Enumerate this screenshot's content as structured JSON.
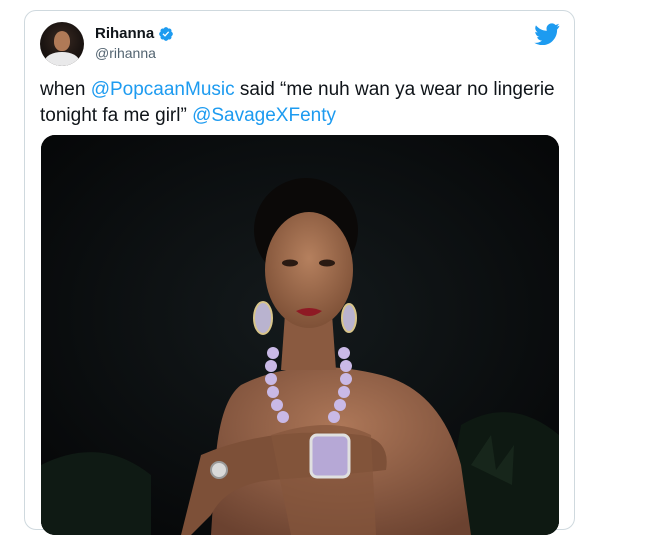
{
  "tweet": {
    "author": {
      "display_name": "Rihanna",
      "handle": "@rihanna",
      "verified": true,
      "avatar_icon": "profile-photo"
    },
    "text_segments": [
      {
        "type": "text",
        "value": "when "
      },
      {
        "type": "mention",
        "value": "@PopcaanMusic"
      },
      {
        "type": "text",
        "value": " said “me nuh wan ya wear no lingerie tonight fa me girl” "
      },
      {
        "type": "mention",
        "value": "@SavageXFenty"
      }
    ],
    "media": {
      "kind": "photo",
      "icon": "photo"
    },
    "platform_icon": "twitter-bird-icon"
  },
  "colors": {
    "mention": "#1d9bf0",
    "verified": "#1d9bf0",
    "brand": "#1d9bf0",
    "text": "#0f1419",
    "secondary": "#536471",
    "border": "#cfd9de"
  }
}
